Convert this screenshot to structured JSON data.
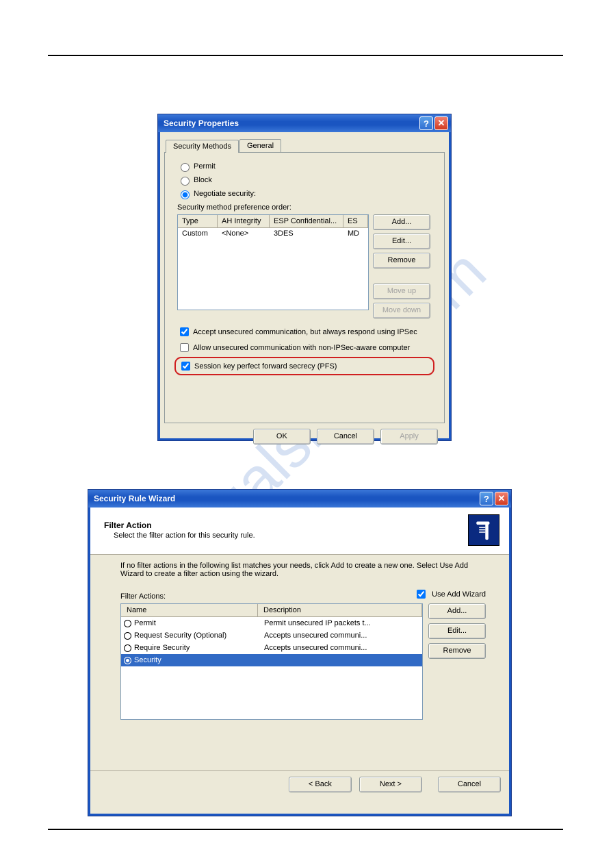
{
  "watermark": "manualshive.com",
  "dialog1": {
    "title": "Security Properties",
    "tabs": [
      "Security Methods",
      "General"
    ],
    "radios": {
      "permit": "Permit",
      "block": "Block",
      "negotiate": "Negotiate security:"
    },
    "pref_label": "Security method preference order:",
    "columns": {
      "c1": "Type",
      "c2": "AH Integrity",
      "c3": "ESP Confidential...",
      "c4": "ES"
    },
    "row": {
      "c1": "Custom",
      "c2": "<None>",
      "c3": "3DES",
      "c4": "MD"
    },
    "side_buttons": {
      "add": "Add...",
      "edit": "Edit...",
      "remove": "Remove",
      "moveup": "Move up",
      "movedown": "Move down"
    },
    "checks": {
      "accept": "Accept unsecured communication, but always respond using IPSec",
      "allow": "Allow unsecured communication with non-IPSec-aware computer",
      "pfs": "Session key perfect forward secrecy (PFS)"
    },
    "buttons": {
      "ok": "OK",
      "cancel": "Cancel",
      "apply": "Apply"
    }
  },
  "dialog2": {
    "title": "Security Rule Wizard",
    "head_title": "Filter Action",
    "head_sub": "Select the filter action for this security rule.",
    "intro": "If no filter actions in the following list matches your needs, click Add to create a new one. Select Use Add Wizard to create a filter action using the wizard.",
    "filter_label": "Filter Actions:",
    "use_add_wizard": "Use Add Wizard",
    "columns": {
      "name": "Name",
      "desc": "Description"
    },
    "rows": [
      {
        "name": "Permit",
        "desc": "Permit unsecured IP packets t...",
        "selected": false
      },
      {
        "name": "Request Security (Optional)",
        "desc": "Accepts unsecured communi...",
        "selected": false
      },
      {
        "name": "Require Security",
        "desc": "Accepts unsecured communi...",
        "selected": false
      },
      {
        "name": "Security",
        "desc": "",
        "selected": true
      }
    ],
    "side_buttons": {
      "add": "Add...",
      "edit": "Edit...",
      "remove": "Remove"
    },
    "buttons": {
      "back": "< Back",
      "next": "Next >",
      "cancel": "Cancel"
    }
  }
}
